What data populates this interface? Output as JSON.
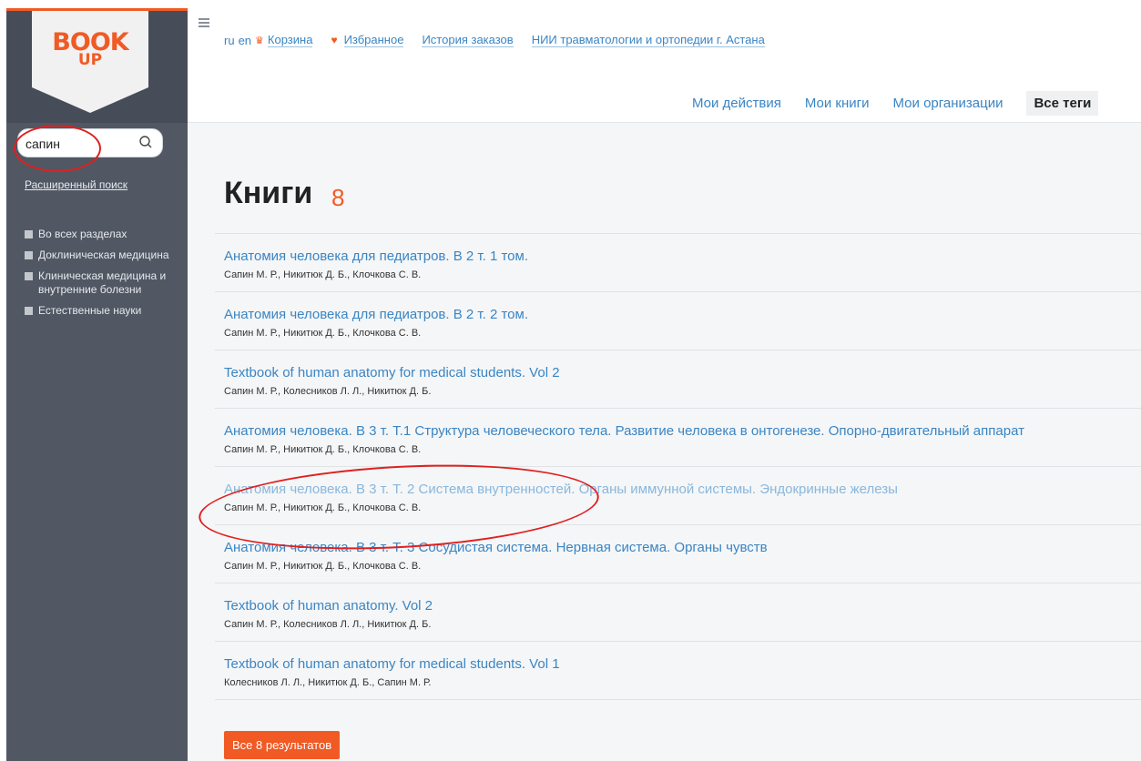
{
  "logo": {
    "text": "BOOK",
    "sub": "UP"
  },
  "search": {
    "value": "сапин",
    "advanced_label": "Расширенный поиск"
  },
  "categories": [
    {
      "label": "Во всех разделах"
    },
    {
      "label": "Доклиническая медицина"
    },
    {
      "label": "Клиническая медицина и внутренние болезни"
    },
    {
      "label": "Естественные науки"
    }
  ],
  "header": {
    "lang_ru": "ru",
    "lang_en": "en",
    "cart": "Корзина",
    "favorites": "Избранное",
    "order_history": "История заказов",
    "organization": "НИИ травматологии и ортопедии г. Астана",
    "tabs": [
      "Мои действия",
      "Мои книги",
      "Мои организации",
      "Все теги"
    ]
  },
  "main": {
    "title": "Книги",
    "count": "8",
    "results": [
      {
        "title": "Анатомия человека для педиатров. В 2 т. 1 том.",
        "authors": "Сапин М. Р., Никитюк Д. Б., Клочкова С. В."
      },
      {
        "title": "Анатомия человека для педиатров. В 2 т. 2 том.",
        "authors": "Сапин М. Р., Никитюк Д. Б., Клочкова С. В."
      },
      {
        "title": "Textbook of human anatomy for medical students. Vol 2",
        "authors": "Сапин М. Р., Колесников Л. Л., Никитюк Д. Б."
      },
      {
        "title": "Анатомия человека. В 3 т. Т.1 Структура человеческого тела. Развитие человека в онтогенезе. Опорно-двигательный аппарат",
        "authors": "Сапин М. Р., Никитюк Д. Б., Клочкова С. В."
      },
      {
        "title": "Анатомия человека. В 3 т. Т. 2 Система внутренностей. Органы иммунной системы. Эндокринные железы",
        "authors": "Сапин М. Р., Никитюк Д. Б., Клочкова С. В."
      },
      {
        "title": "Анатомия человека. В 3 т. Т. 3 Сосудистая система. Нервная система. Органы чувств",
        "authors": "Сапин М. Р., Никитюк Д. Б., Клочкова С. В."
      },
      {
        "title": "Textbook of human anatomy. Vol 2",
        "authors": "Сапин М. Р., Колесников Л. Л., Никитюк Д. Б."
      },
      {
        "title": "Textbook of human anatomy for medical students. Vol 1",
        "authors": "Колесников Л. Л., Никитюк Д. Б., Сапин М. Р."
      }
    ],
    "all_button": "Все 8 результатов"
  },
  "colors": {
    "accent": "#f15a24",
    "link": "#3a85c4",
    "sidebar": "#515763",
    "annotation": "#e02020"
  }
}
